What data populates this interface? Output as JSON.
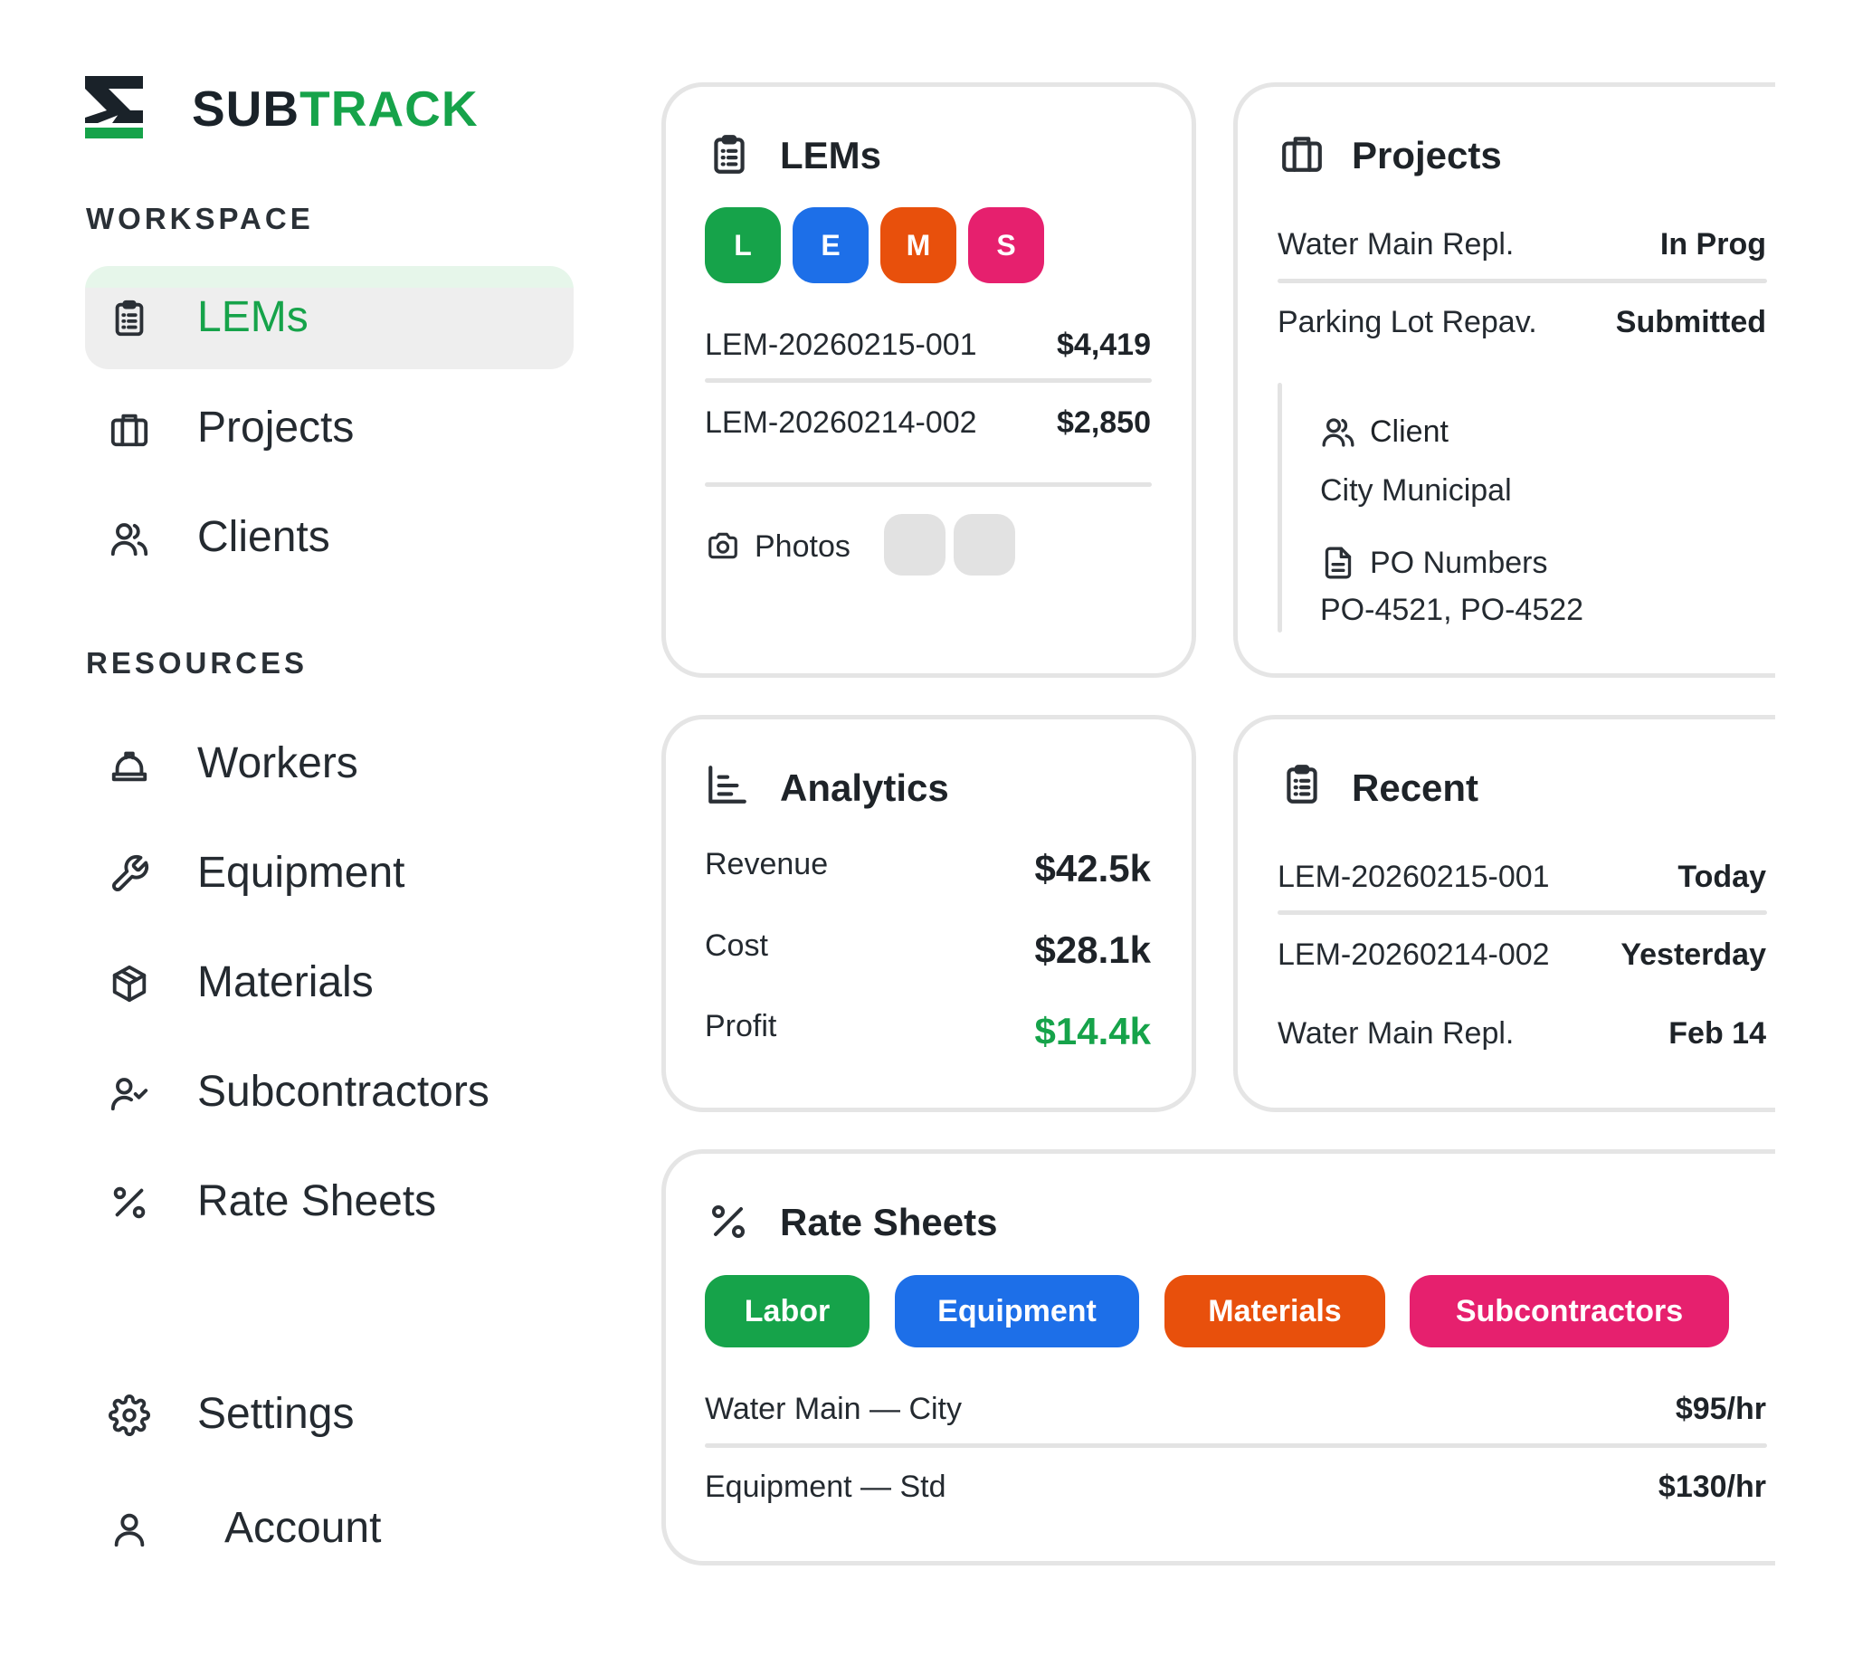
{
  "brand": {
    "part1": "SUB",
    "part2": "TRACK"
  },
  "colors": {
    "green": "#16a34a",
    "blue": "#1d6fe8",
    "orange": "#e8500c",
    "pink": "#e6206e"
  },
  "sidebar": {
    "workspace_label": "WORKSPACE",
    "resources_label": "RESOURCES",
    "items": [
      {
        "label": "LEMs",
        "icon": "clipboard-list-icon",
        "active": true
      },
      {
        "label": "Projects",
        "icon": "briefcase-icon"
      },
      {
        "label": "Clients",
        "icon": "users-icon"
      },
      {
        "label": "Workers",
        "icon": "hard-hat-icon"
      },
      {
        "label": "Equipment",
        "icon": "wrench-icon"
      },
      {
        "label": "Materials",
        "icon": "package-icon"
      },
      {
        "label": "Subcontractors",
        "icon": "user-check-icon"
      },
      {
        "label": "Rate Sheets",
        "icon": "percent-icon"
      },
      {
        "label": "Settings",
        "icon": "gear-icon"
      },
      {
        "label": "Account",
        "icon": "user-icon"
      }
    ]
  },
  "lems_card": {
    "title": "LEMs",
    "badges": [
      "L",
      "E",
      "M",
      "S"
    ],
    "rows": [
      {
        "id": "LEM-20260215-001",
        "amount": "$4,419"
      },
      {
        "id": "LEM-20260214-002",
        "amount": "$2,850"
      }
    ],
    "photos_label": "Photos"
  },
  "projects_card": {
    "title": "Projects",
    "rows": [
      {
        "name": "Water Main Repl.",
        "status": "In Prog"
      },
      {
        "name": "Parking Lot Repav.",
        "status": "Submitted"
      }
    ],
    "client_label": "Client",
    "client_value": "City Municipal",
    "po_label": "PO Numbers",
    "po_value": "PO-4521, PO-4522"
  },
  "analytics_card": {
    "title": "Analytics",
    "rows": [
      {
        "label": "Revenue",
        "value": "$42.5k"
      },
      {
        "label": "Cost",
        "value": "$28.1k"
      },
      {
        "label": "Profit",
        "value": "$14.4k"
      }
    ]
  },
  "recent_card": {
    "title": "Recent",
    "rows": [
      {
        "name": "LEM-20260215-001",
        "when": "Today"
      },
      {
        "name": "LEM-20260214-002",
        "when": "Yesterday"
      },
      {
        "name": "Water Main Repl.",
        "when": "Feb 14"
      }
    ]
  },
  "rates_card": {
    "title": "Rate Sheets",
    "chips": [
      "Labor",
      "Equipment",
      "Materials",
      "Subcontractors"
    ],
    "rows": [
      {
        "name": "Water Main — City",
        "rate": "$95/hr"
      },
      {
        "name": "Equipment — Std",
        "rate": "$130/hr"
      }
    ]
  }
}
